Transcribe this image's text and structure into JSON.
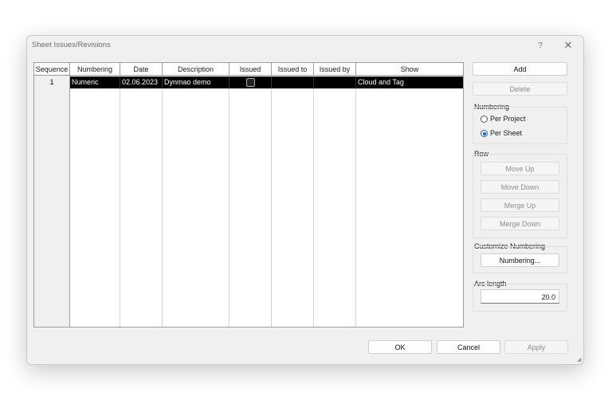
{
  "window": {
    "title": "Sheet Issues/Revisions",
    "help_label": "?",
    "close_label": "✕"
  },
  "table": {
    "columns": [
      "Sequence",
      "Numbering",
      "Date",
      "Description",
      "Issued",
      "Issued to",
      "Issued by",
      "Show"
    ],
    "rows": [
      {
        "sequence": "1",
        "numbering": "Numeric",
        "date": "02.06.2023",
        "description": "Dynmao demo",
        "issued": false,
        "issued_to": "",
        "issued_by": "",
        "show": "Cloud and Tag"
      }
    ]
  },
  "actions": {
    "add": "Add",
    "delete": "Delete"
  },
  "numbering": {
    "label": "Numbering",
    "options": [
      "Per Project",
      "Per Sheet"
    ],
    "selected": "Per Sheet"
  },
  "row": {
    "label": "Row",
    "move_up": "Move Up",
    "move_down": "Move Down",
    "merge_up": "Merge Up",
    "merge_down": "Merge Down"
  },
  "customize": {
    "label": "Customize Numbering",
    "button": "Numbering..."
  },
  "arc": {
    "label": "Arc length",
    "value": "20.0"
  },
  "footer": {
    "ok": "OK",
    "cancel": "Cancel",
    "apply": "Apply"
  }
}
